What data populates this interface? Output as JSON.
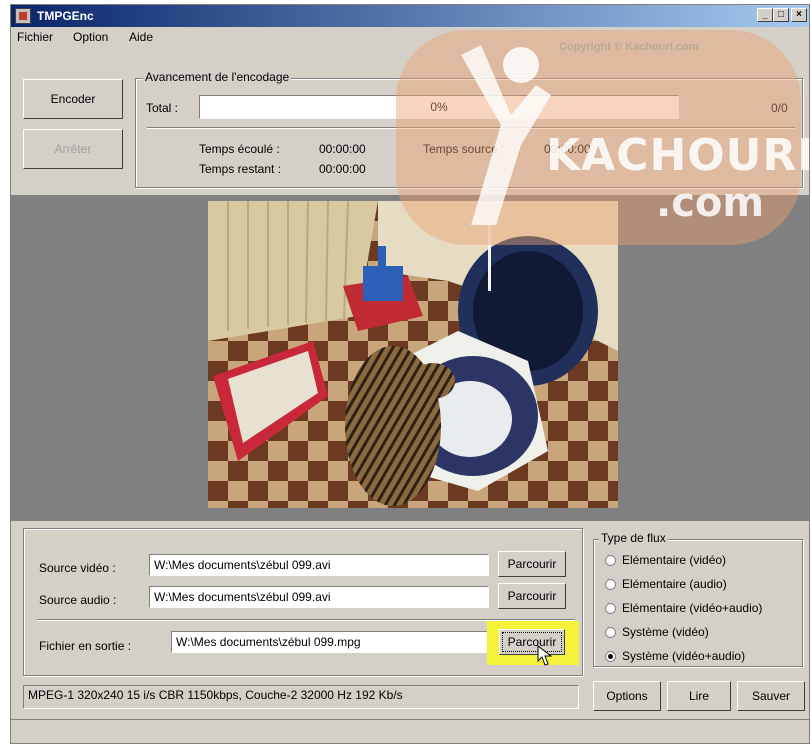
{
  "window": {
    "title": "TMPGEnc"
  },
  "menu": [
    "Fichier",
    "Option",
    "Aide"
  ],
  "copyright": "Copyright © Kachouri.com",
  "watermark": {
    "line1": "KACHOURI",
    "line2": ".com"
  },
  "buttons": {
    "encode": "Encoder",
    "stop": "Arrêter"
  },
  "progress": {
    "group_label": "Avancement de l'encodage",
    "total_label": "Total :",
    "percent_text": "0%",
    "fraction": 0,
    "count": "0/0",
    "elapsed_label": "Temps écoulé :",
    "elapsed_value": "00:00:00",
    "remaining_label": "Temps restant :",
    "remaining_value": "00:00:00",
    "source_time_label": "Temps source :",
    "source_time_value": "00:00:00"
  },
  "files": {
    "video_label": "Source vidéo :",
    "video_value": "W:\\Mes documents\\zébul 099.avi",
    "audio_label": "Source audio :",
    "audio_value": "W:\\Mes documents\\zébul 099.avi",
    "output_label": "Fichier en sortie :",
    "output_value": "W:\\Mes documents\\zébul 099.mpg",
    "browse": "Parcourir"
  },
  "stream_type": {
    "label": "Type de flux",
    "options": [
      "Elémentaire (vidéo)",
      "Elémentaire (audio)",
      "Elémentaire (vidéo+audio)",
      "Système (vidéo)",
      "Système (vidéo+audio)"
    ],
    "selected": "Système (vidéo+audio)"
  },
  "settings_summary": "MPEG-1 320x240 15 i/s CBR 1150kbps,  Couche-2 32000 Hz 192 Kb/s",
  "bottom_buttons": {
    "options": "Options",
    "play": "Lire",
    "save": "Sauver"
  },
  "colors": {
    "titlebar": "#0a246a",
    "face": "#d4d0c8",
    "highlight": "#f5f23a",
    "watermark": "#eaa06e"
  }
}
